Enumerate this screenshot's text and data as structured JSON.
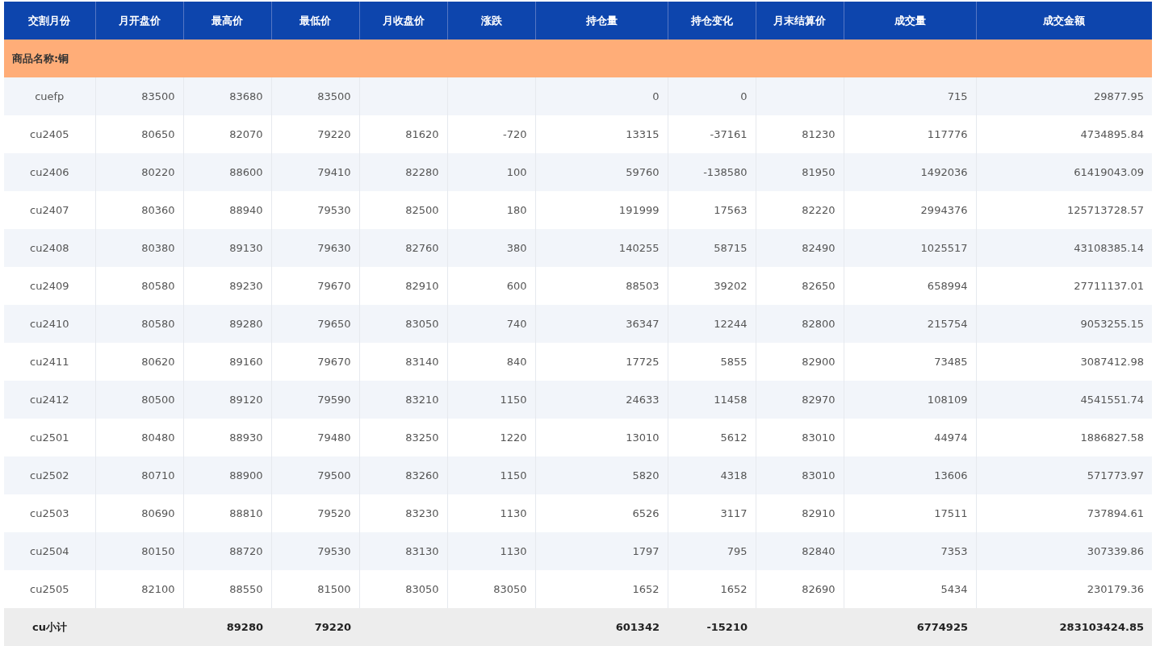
{
  "table": {
    "columns": [
      "交割月份",
      "月开盘价",
      "最高价",
      "最低价",
      "月收盘价",
      "涨跌",
      "持仓量",
      "持仓变化",
      "月末结算价",
      "成交量",
      "成交金额"
    ],
    "group_label": "商品名称:铜",
    "rows": [
      {
        "month": "cuefp",
        "open": "83500",
        "high": "83680",
        "low": "83500",
        "open_interest": "0",
        "oi_change": "0",
        "volume": "715",
        "turnover": "29877.95"
      },
      {
        "month": "cu2405",
        "open": "80650",
        "high": "82070",
        "low": "79220",
        "close": "81620",
        "change": "-720",
        "open_interest": "13315",
        "oi_change": "-37161",
        "settle": "81230",
        "volume": "117776",
        "turnover": "4734895.84"
      },
      {
        "month": "cu2406",
        "open": "80220",
        "high": "88600",
        "low": "79410",
        "close": "82280",
        "change": "100",
        "open_interest": "59760",
        "oi_change": "-138580",
        "settle": "81950",
        "volume": "1492036",
        "turnover": "61419043.09"
      },
      {
        "month": "cu2407",
        "open": "80360",
        "high": "88940",
        "low": "79530",
        "close": "82500",
        "change": "180",
        "open_interest": "191999",
        "oi_change": "17563",
        "settle": "82220",
        "volume": "2994376",
        "turnover": "125713728.57"
      },
      {
        "month": "cu2408",
        "open": "80380",
        "high": "89130",
        "low": "79630",
        "close": "82760",
        "change": "380",
        "open_interest": "140255",
        "oi_change": "58715",
        "settle": "82490",
        "volume": "1025517",
        "turnover": "43108385.14"
      },
      {
        "month": "cu2409",
        "open": "80580",
        "high": "89230",
        "low": "79670",
        "close": "82910",
        "change": "600",
        "open_interest": "88503",
        "oi_change": "39202",
        "settle": "82650",
        "volume": "658994",
        "turnover": "27711137.01"
      },
      {
        "month": "cu2410",
        "open": "80580",
        "high": "89280",
        "low": "79650",
        "close": "83050",
        "change": "740",
        "open_interest": "36347",
        "oi_change": "12244",
        "settle": "82800",
        "volume": "215754",
        "turnover": "9053255.15"
      },
      {
        "month": "cu2411",
        "open": "80620",
        "high": "89160",
        "low": "79670",
        "close": "83140",
        "change": "840",
        "open_interest": "17725",
        "oi_change": "5855",
        "settle": "82900",
        "volume": "73485",
        "turnover": "3087412.98"
      },
      {
        "month": "cu2412",
        "open": "80500",
        "high": "89120",
        "low": "79590",
        "close": "83210",
        "change": "1150",
        "open_interest": "24633",
        "oi_change": "11458",
        "settle": "82970",
        "volume": "108109",
        "turnover": "4541551.74"
      },
      {
        "month": "cu2501",
        "open": "80480",
        "high": "88930",
        "low": "79480",
        "close": "83250",
        "change": "1220",
        "open_interest": "13010",
        "oi_change": "5612",
        "settle": "83010",
        "volume": "44974",
        "turnover": "1886827.58"
      },
      {
        "month": "cu2502",
        "open": "80710",
        "high": "88900",
        "low": "79500",
        "close": "83260",
        "change": "1150",
        "open_interest": "5820",
        "oi_change": "4318",
        "settle": "83010",
        "volume": "13606",
        "turnover": "571773.97"
      },
      {
        "month": "cu2503",
        "open": "80690",
        "high": "88810",
        "low": "79520",
        "close": "83230",
        "change": "1130",
        "open_interest": "6526",
        "oi_change": "3117",
        "settle": "82910",
        "volume": "17511",
        "turnover": "737894.61"
      },
      {
        "month": "cu2504",
        "open": "80150",
        "high": "88720",
        "low": "79530",
        "close": "83130",
        "change": "1130",
        "open_interest": "1797",
        "oi_change": "795",
        "settle": "82840",
        "volume": "7353",
        "turnover": "307339.86"
      },
      {
        "month": "cu2505",
        "open": "82100",
        "high": "88550",
        "low": "81500",
        "close": "83050",
        "change": "83050",
        "open_interest": "1652",
        "oi_change": "1652",
        "settle": "82690",
        "volume": "5434",
        "turnover": "230179.36"
      }
    ],
    "total": {
      "month": "cu小计",
      "high": "89280",
      "low": "79220",
      "open_interest": "601342",
      "oi_change": "-15210",
      "volume": "6774925",
      "turnover": "283103424.85"
    }
  }
}
